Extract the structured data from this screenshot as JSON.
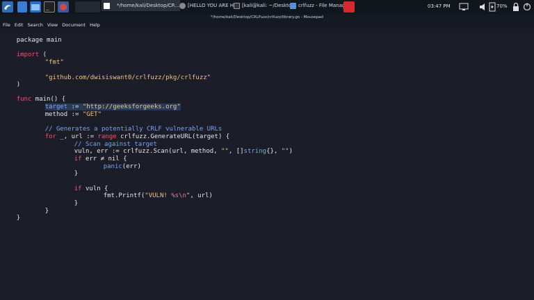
{
  "taskbar": {
    "tasks": [
      {
        "label": "*/home/kali/Desktop/CR...",
        "icon": "mousepad-icon"
      },
      {
        "label": "[HELLO YOU ARE HACK...",
        "icon": "browser-icon"
      },
      {
        "label": "[kali@kali: ~/Desktop/C...",
        "icon": "terminal-icon"
      },
      {
        "label": "crlfuzz - File Manager",
        "icon": "folder-icon"
      }
    ],
    "clock": "03:47 PM",
    "battery": "70%"
  },
  "window": {
    "title": "*/home/kali/Desktop/CRLFuzz/crlfuzz/library.go - Mousepad"
  },
  "menu": [
    "File",
    "Edit",
    "Search",
    "View",
    "Document",
    "Help"
  ],
  "code": {
    "l1": "package main",
    "l3a": "import",
    "l3b": " (",
    "l4": "\"fmt\"",
    "l6": "\"github.com/dwisiswant0/crlfuzz/pkg/crlfuzz\"",
    "l7": ")",
    "l9a": "func",
    "l9b": " main() {",
    "l10a": "target",
    "l10b": " := ",
    "l10c": "\"http://geeksforgeeks.org\"",
    "l11a": "method",
    "l11b": " := ",
    "l11c": "\"GET\"",
    "l13": "// Generates a potentially CRLF vulnerable URLs",
    "l14a": "for",
    "l14b": " _, url := ",
    "l14c": "range",
    "l14d": " crlfuzz.GenerateURL(target) {",
    "l15": "// Scan against target",
    "l16a": "vuln, err := crlfuzz.Scan(url, method, ",
    "l16b": "\"\"",
    "l16c": ", []",
    "l16d": "string",
    "l16e": "{}, ",
    "l16f": "\"\"",
    "l16g": ")",
    "l17a": "if",
    "l17b": " err ≠ nil {",
    "l18a": "panic",
    "l18b": "(err)",
    "l19": "}",
    "l21a": "if",
    "l21b": " vuln {",
    "l22a": "fmt.Printf(",
    "l22b": "\"VULN! ",
    "l22c": "%s\\n",
    "l22d": "\"",
    "l22e": ", url)",
    "l23": "}",
    "l24": "}",
    "l25": "}"
  }
}
